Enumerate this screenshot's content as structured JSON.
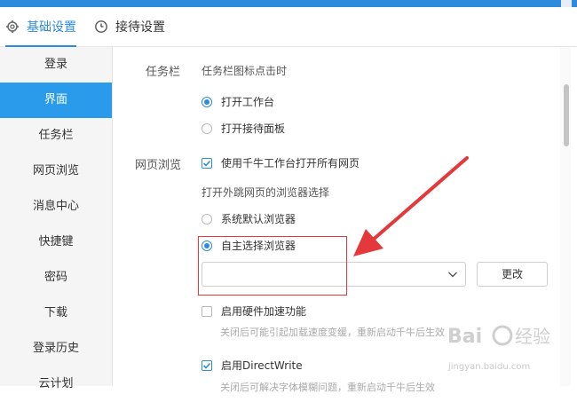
{
  "tabs": [
    {
      "label": "基础设置",
      "icon": "gear-icon",
      "active": true
    },
    {
      "label": "接待设置",
      "icon": "clock-icon",
      "active": false
    }
  ],
  "sidebar": {
    "items": [
      {
        "label": "登录"
      },
      {
        "label": "界面",
        "active": true
      },
      {
        "label": "任务栏"
      },
      {
        "label": "网页浏览"
      },
      {
        "label": "消息中心"
      },
      {
        "label": "快捷键"
      },
      {
        "label": "密码"
      },
      {
        "label": "下载"
      },
      {
        "label": "登录历史"
      },
      {
        "label": "云计划"
      }
    ]
  },
  "taskbar": {
    "section_label": "任务栏",
    "sublabel": "任务栏图标点击时",
    "options": [
      {
        "label": "打开工作台",
        "checked": true
      },
      {
        "label": "打开接待面板",
        "checked": false
      }
    ]
  },
  "web": {
    "section_label": "网页浏览",
    "use_workbench": {
      "label": "使用千牛工作台打开所有网页",
      "checked": true
    },
    "browser_select_label": "打开外跳网页的浏览器选择",
    "options": [
      {
        "label": "系统默认浏览器",
        "checked": false
      },
      {
        "label": "自主选择浏览器",
        "checked": true
      }
    ],
    "browser_path_value": "",
    "change_button": "更改",
    "hw_accel": {
      "label": "启用硬件加速功能",
      "checked": false
    },
    "hw_accel_hint": "关闭后可能引起加载速度变缓，重新启动千牛后生效",
    "directwrite": {
      "label": "启用DirectWrite",
      "checked": true
    },
    "directwrite_hint": "关闭后可解决字体模糊问题，重新启动千牛后生效"
  },
  "colors": {
    "accent": "#2d8bde",
    "sidebar_active": "#2a9bea",
    "annotation": "#e4393c"
  },
  "watermark": {
    "logo_text": "Bai 经验",
    "url": "jingyan.baidu.com"
  }
}
